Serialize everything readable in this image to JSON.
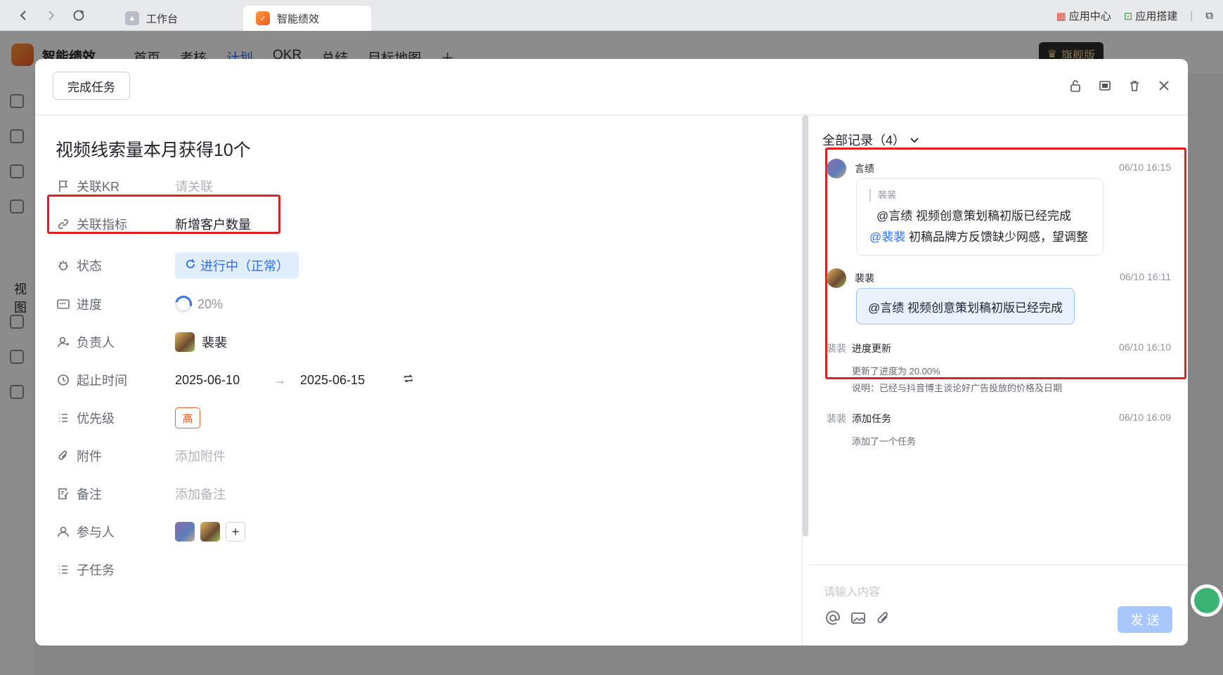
{
  "browser": {
    "tabs": [
      {
        "label": "工作台"
      },
      {
        "label": "智能绩效"
      }
    ],
    "right_links": [
      {
        "label": "应用中心"
      },
      {
        "label": "应用搭建"
      }
    ]
  },
  "app": {
    "name": "智能绩效",
    "nav": [
      "首页",
      "考核",
      "计划",
      "OKR",
      "总结",
      "目标地图"
    ],
    "vip_label": "旗舰版",
    "rail_label": "视图"
  },
  "modal": {
    "complete_button": "完成任务",
    "title": "视频线索量本月获得10个",
    "fields": {
      "kr": {
        "label": "关联KR",
        "value": "请关联"
      },
      "metric": {
        "label": "关联指标",
        "value": "新增客户数量"
      },
      "status": {
        "label": "状态",
        "value": "进行中（正常）"
      },
      "progress": {
        "label": "进度",
        "value": "20%",
        "fraction": 0.2
      },
      "owner": {
        "label": "负责人",
        "value": "裴裴"
      },
      "dates": {
        "label": "起止时间",
        "start": "2025-06-10",
        "arrow": "→",
        "end": "2025-06-15"
      },
      "priority": {
        "label": "优先级",
        "value": "高"
      },
      "attachment": {
        "label": "附件",
        "value": "添加附件"
      },
      "note": {
        "label": "备注",
        "value": "添加备注"
      },
      "participants": {
        "label": "参与人"
      },
      "subtasks": {
        "label": "子任务"
      }
    }
  },
  "records": {
    "header": "全部记录（4）",
    "items": [
      {
        "name": "言绩",
        "time": "06/10 16:15",
        "quote_author": "裴裴",
        "quote_text": "@言绩 视频创意策划稿初版已经完成",
        "mention": "@裴裴",
        "reply": " 初稿品牌方反馈缺少网感，望调整"
      },
      {
        "name": "裴裴",
        "time": "06/10 16:11",
        "text": "@言绩 视频创意策划稿初版已经完成"
      },
      {
        "who": "裴裴",
        "action": "进度更新",
        "time": "06/10 16:10",
        "detail1": "更新了进度为 20.00%",
        "detail2": "说明：已经与抖音博主谈论好广告投放的价格及日期"
      },
      {
        "who": "裴裴",
        "action": "添加任务",
        "time": "06/10 16:09",
        "detail1": "添加了一个任务"
      }
    ],
    "composer_placeholder": "请输入内容",
    "send_button": "发 送"
  }
}
